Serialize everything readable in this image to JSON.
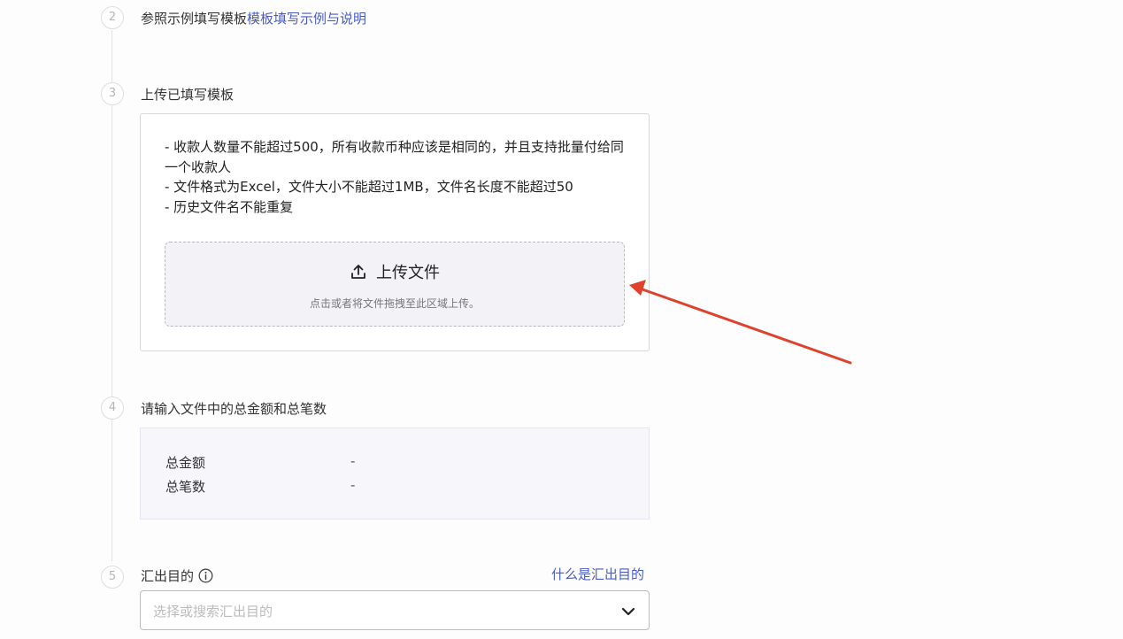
{
  "steps": [
    {
      "num": "2",
      "title": "参照示例填写模板",
      "link": "模板填写示例与说明"
    },
    {
      "num": "3",
      "title": "上传已填写模板"
    },
    {
      "num": "4",
      "title": "请输入文件中的总金额和总笔数"
    },
    {
      "num": "5",
      "title": "汇出目的",
      "link": "什么是汇出目的"
    }
  ],
  "upload": {
    "notes": [
      "- 收款人数量不能超过500，所有收款币种应该是相同的，并且支持批量付给同一个收款人",
      "- 文件格式为Excel，文件大小不能超过1MB，文件名长度不能超过50",
      "- 历史文件名不能重复"
    ],
    "button_label": "上传文件",
    "hint": "点击或者将文件拖拽至此区域上传。",
    "icon": "upload-icon"
  },
  "totals": {
    "rows": [
      {
        "label": "总金额",
        "value": "-"
      },
      {
        "label": "总笔数",
        "value": "-"
      }
    ]
  },
  "purpose": {
    "placeholder": "选择或搜索汇出目的",
    "icons": [
      "info-icon",
      "chevron-down-icon"
    ]
  },
  "colors": {
    "link": "#4a5cc4",
    "annotation_arrow": "#e0412c",
    "dropzone_bg": "#f3f2f7"
  }
}
